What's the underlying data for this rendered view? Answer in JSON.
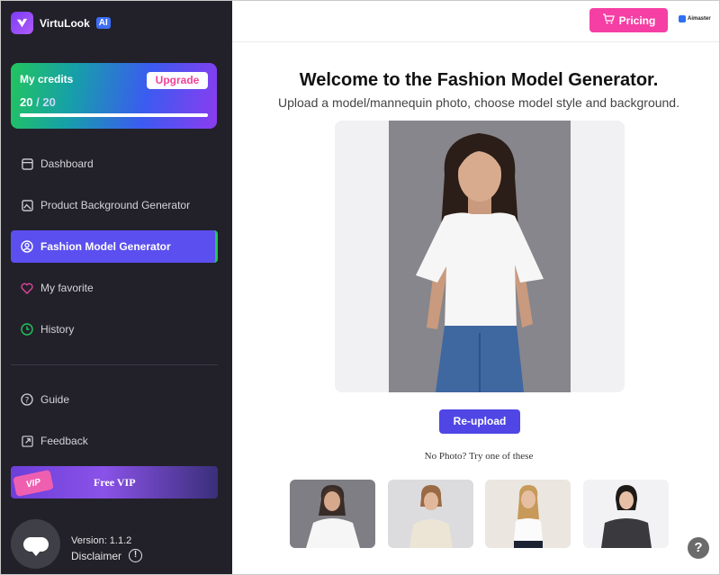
{
  "app": {
    "name": "VirtuLook",
    "badge": "AI"
  },
  "credits": {
    "title": "My credits",
    "upgrade_label": "Upgrade",
    "used": "20",
    "separator": "/",
    "total": "20",
    "progress_fraction": 1.0
  },
  "nav": {
    "dashboard": "Dashboard",
    "product_bg": "Product Background Generator",
    "fashion_model": "Fashion Model Generator",
    "favorite": "My favorite",
    "history": "History",
    "guide": "Guide",
    "feedback": "Feedback"
  },
  "vip": {
    "ticket": "VIP",
    "label": "Free VIP"
  },
  "footer": {
    "version": "Version: 1.1.2",
    "disclaimer": "Disclaimer"
  },
  "topbar": {
    "pricing_label": "Pricing",
    "partner": "Aimaster"
  },
  "main": {
    "title": "Welcome to the Fashion Model Generator.",
    "subtitle": "Upload a model/mannequin photo, choose model style and background.",
    "reupload_label": "Re-upload",
    "no_photo_text": "No Photo? Try one of these"
  },
  "colors": {
    "accent": "#5b4fef",
    "pink": "#f53fa4",
    "sidebar_bg": "#22212a",
    "active_border": "#22c55e"
  }
}
